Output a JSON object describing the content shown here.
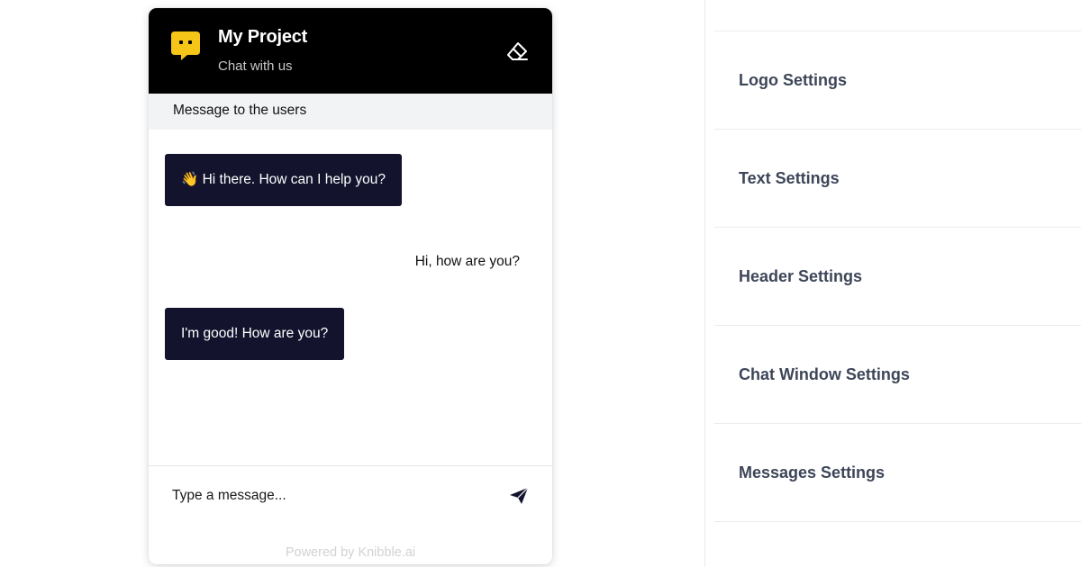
{
  "chat": {
    "title": "My Project",
    "subtitle": "Chat with us",
    "logo_icon": "chat-bubble-face-icon",
    "clear_icon": "eraser-icon",
    "notice": "Message to the users",
    "messages": [
      {
        "role": "bot",
        "text": "👋 Hi there. How can I help you?"
      },
      {
        "role": "user",
        "text": "Hi, how are you?"
      },
      {
        "role": "bot",
        "text": "I'm good! How are you?"
      }
    ],
    "input": {
      "placeholder": "Type a message...",
      "value": ""
    },
    "send_icon": "paper-plane-icon",
    "powered_by": "Powered by Knibble.ai",
    "colors": {
      "header_bg": "#000000",
      "logo": "#f5c518",
      "bot_bubble": "#13132e",
      "notice_bg": "#f2f3f5"
    }
  },
  "settings": {
    "sections": [
      {
        "label": "Logo Settings"
      },
      {
        "label": "Text Settings"
      },
      {
        "label": "Header Settings"
      },
      {
        "label": "Chat Window Settings"
      },
      {
        "label": "Messages Settings"
      }
    ],
    "label_color": "#3d4658"
  }
}
